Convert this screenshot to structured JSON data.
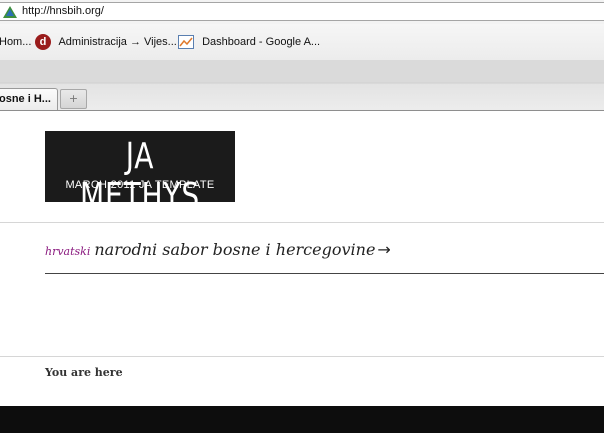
{
  "browser": {
    "url": "http://hnsbih.org/",
    "bookmarks": [
      {
        "label": "Hom...",
        "icon": "home-icon"
      },
      {
        "label": "Administracija → Vijes...",
        "icon": "site-d-icon"
      },
      {
        "label": "Dashboard - Google A...",
        "icon": "chart-icon"
      }
    ],
    "tab_label": "osne i H...",
    "new_tab_symbol": "+"
  },
  "page": {
    "logo": {
      "title": "JA METHYS",
      "subtitle": "MARCH 2011 JA TEMPLATE"
    },
    "nav": {
      "prefix": "hrvatski",
      "title": "narodni sabor bosne i hercegovine",
      "arrow": "→"
    },
    "breadcrumb_label": "You are here"
  },
  "colors": {
    "logo_bg": "#1b1b1b",
    "nav_prefix": "#8a1a7f",
    "footer_bg": "#0d0d0d"
  }
}
